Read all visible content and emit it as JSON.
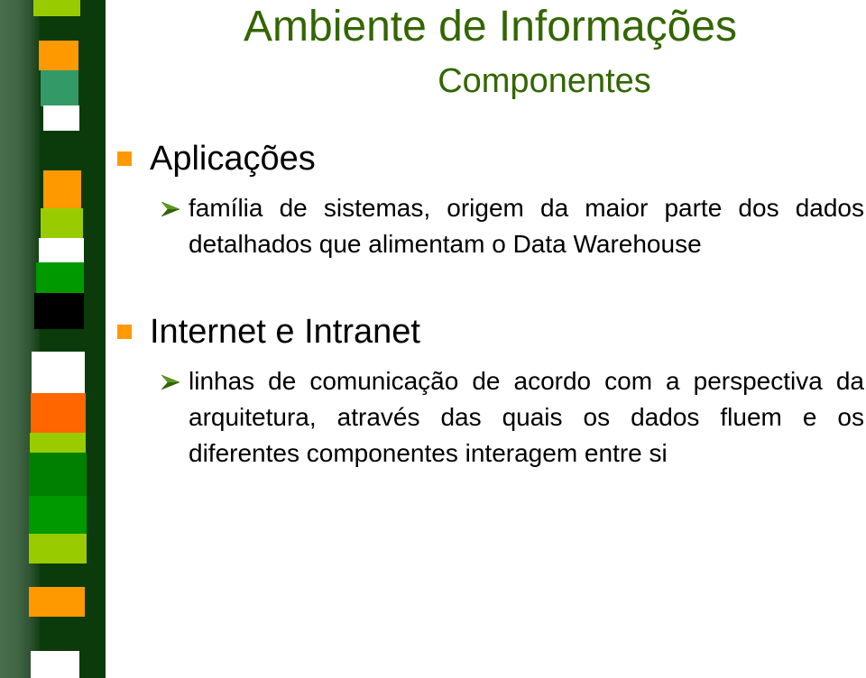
{
  "slide": {
    "title": "Ambiente de Informações",
    "subtitle": "Componentes",
    "sections": [
      {
        "heading": "Aplicações",
        "items": [
          "família de sistemas, origem da maior parte dos dados detalhados que alimentam o Data Warehouse"
        ]
      },
      {
        "heading": "Internet e Intranet",
        "items": [
          "linhas de comunicação de acordo com a perspectiva da arquitetura, através das quais os dados fluem e os diferentes componentes interagem entre si"
        ]
      }
    ]
  },
  "colors": {
    "title": "#336600",
    "bullet_square": "#ff9900",
    "arrow": "#336600",
    "strip_dark": "#0b3a0b",
    "stripes": [
      "#99cc00",
      "#ff9900",
      "#339966",
      "#ffffff",
      "#009900",
      "#000000",
      "#ff6600",
      "#008000"
    ]
  }
}
